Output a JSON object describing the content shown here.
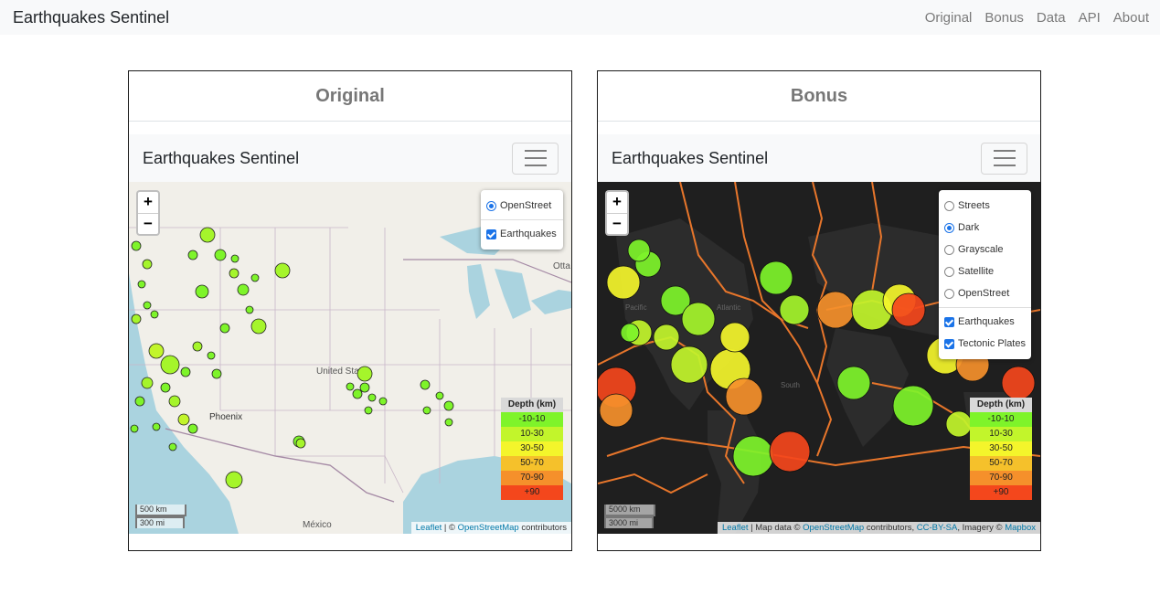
{
  "app": {
    "brand": "Earthquakes Sentinel",
    "nav": [
      "Original",
      "Bonus",
      "Data",
      "API",
      "About"
    ]
  },
  "original": {
    "title": "Original",
    "brand": "Earthquakes Sentinel",
    "base_layers": [
      "OpenStreet"
    ],
    "overlays": [
      "Earthquakes"
    ],
    "map_labels": {
      "city1": "United States",
      "city2": "Phoenix",
      "city3": "México",
      "city4": "Otta"
    },
    "scale": [
      "500 km",
      "300 mi"
    ],
    "attribution": {
      "leaflet": "Leaflet",
      "mid": " | © ",
      "osm": "OpenStreetMap",
      "tail": " contributors"
    }
  },
  "bonus": {
    "title": "Bonus",
    "brand": "Earthquakes Sentinel",
    "base_layers": [
      "Streets",
      "Dark",
      "Grayscale",
      "Satellite",
      "OpenStreet"
    ],
    "selected_base": "Dark",
    "overlays": [
      "Earthquakes",
      "Tectonic Plates"
    ],
    "scale": [
      "5000 km",
      "3000 mi"
    ],
    "attribution": {
      "leaflet": "Leaflet",
      "p1": " | Map data © ",
      "osm": "OpenStreetMap",
      "p2": " contributors, ",
      "cc": "CC-BY-SA",
      "p3": ", Imagery © ",
      "mapbox": "Mapbox"
    }
  },
  "legend": {
    "title": "Depth (km)",
    "ranges": [
      "-10-10",
      "10-30",
      "30-50",
      "50-70",
      "70-90",
      "+90"
    ],
    "colors": [
      "#7ef42a",
      "#c2f52b",
      "#f4f52b",
      "#f5c12b",
      "#f5902b",
      "#f4471c"
    ]
  },
  "zoom": {
    "in": "+",
    "out": "−"
  }
}
